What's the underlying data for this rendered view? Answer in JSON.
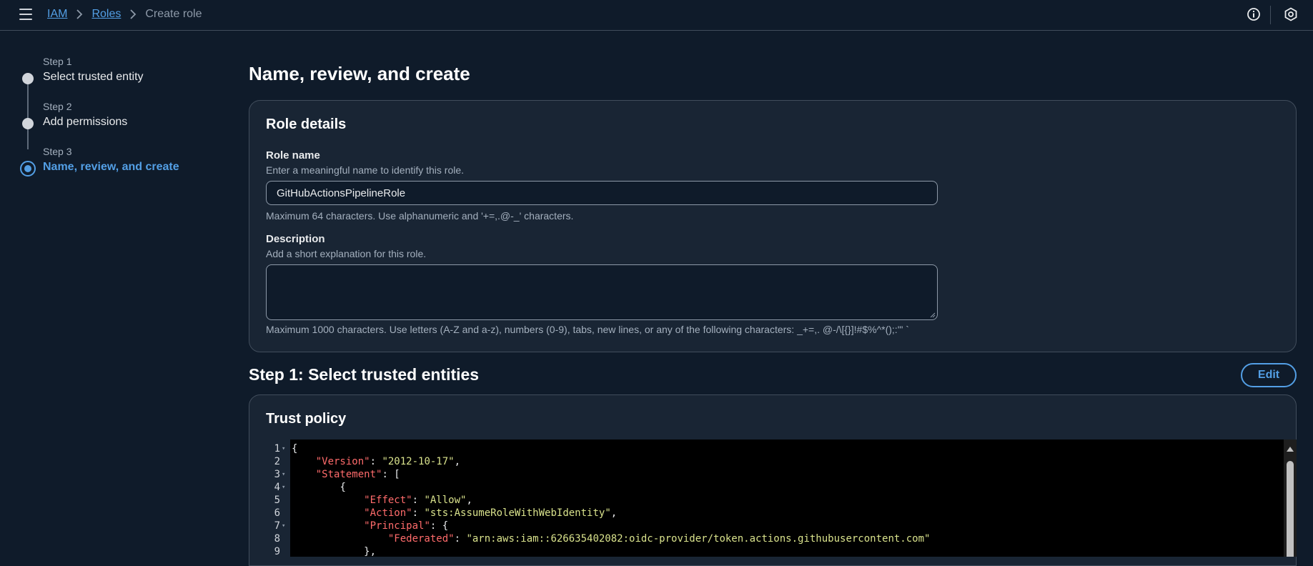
{
  "breadcrumb": {
    "items": [
      {
        "label": "IAM"
      },
      {
        "label": "Roles"
      }
    ],
    "current": "Create role"
  },
  "steps": [
    {
      "number": "Step 1",
      "title": "Select trusted entity"
    },
    {
      "number": "Step 2",
      "title": "Add permissions"
    },
    {
      "number": "Step 3",
      "title": "Name, review, and create"
    }
  ],
  "main": {
    "title": "Name, review, and create",
    "role_details": {
      "title": "Role details",
      "role_name_label": "Role name",
      "role_name_desc": "Enter a meaningful name to identify this role.",
      "role_name_value": "GitHubActionsPipelineRole",
      "role_name_hint": "Maximum 64 characters. Use alphanumeric and '+=,.@-_' characters.",
      "description_label": "Description",
      "description_desc": "Add a short explanation for this role.",
      "description_value": "",
      "description_hint": "Maximum 1000 characters. Use letters (A-Z and a-z), numbers (0-9), tabs, new lines, or any of the following characters: _+=,. @-/\\[{}]!#$%^*();:'\" `"
    },
    "step1": {
      "title": "Step 1: Select trusted entities",
      "edit_label": "Edit",
      "trust_policy_title": "Trust policy"
    },
    "code_lines": [
      {
        "n": "1",
        "fold": true,
        "indent": "",
        "parts": [
          {
            "t": "p",
            "v": "{"
          }
        ]
      },
      {
        "n": "2",
        "fold": false,
        "indent": "    ",
        "parts": [
          {
            "t": "k",
            "v": "\"Version\""
          },
          {
            "t": "p",
            "v": ": "
          },
          {
            "t": "s",
            "v": "\"2012-10-17\""
          },
          {
            "t": "p",
            "v": ","
          }
        ]
      },
      {
        "n": "3",
        "fold": true,
        "indent": "    ",
        "parts": [
          {
            "t": "k",
            "v": "\"Statement\""
          },
          {
            "t": "p",
            "v": ": ["
          }
        ]
      },
      {
        "n": "4",
        "fold": true,
        "indent": "        ",
        "parts": [
          {
            "t": "p",
            "v": "{"
          }
        ]
      },
      {
        "n": "5",
        "fold": false,
        "indent": "            ",
        "parts": [
          {
            "t": "k",
            "v": "\"Effect\""
          },
          {
            "t": "p",
            "v": ": "
          },
          {
            "t": "s",
            "v": "\"Allow\""
          },
          {
            "t": "p",
            "v": ","
          }
        ]
      },
      {
        "n": "6",
        "fold": false,
        "indent": "            ",
        "parts": [
          {
            "t": "k",
            "v": "\"Action\""
          },
          {
            "t": "p",
            "v": ": "
          },
          {
            "t": "s",
            "v": "\"sts:AssumeRoleWithWebIdentity\""
          },
          {
            "t": "p",
            "v": ","
          }
        ]
      },
      {
        "n": "7",
        "fold": true,
        "indent": "            ",
        "parts": [
          {
            "t": "k",
            "v": "\"Principal\""
          },
          {
            "t": "p",
            "v": ": {"
          }
        ]
      },
      {
        "n": "8",
        "fold": false,
        "indent": "                ",
        "parts": [
          {
            "t": "k",
            "v": "\"Federated\""
          },
          {
            "t": "p",
            "v": ": "
          },
          {
            "t": "s",
            "v": "\"arn:aws:iam::626635402082:oidc-provider/token.actions.githubusercontent.com\""
          }
        ]
      },
      {
        "n": "9",
        "fold": false,
        "indent": "            ",
        "parts": [
          {
            "t": "p",
            "v": "},"
          }
        ]
      }
    ]
  },
  "icons": {
    "menu": "hamburger-menu-icon",
    "info": "info-icon",
    "settings": "hexagon-settings-icon"
  },
  "colors": {
    "background": "#0f1b2a",
    "panel": "#192534",
    "accent": "#539fe5",
    "json_key": "#ff6b6b",
    "json_string": "#d9e28c"
  }
}
